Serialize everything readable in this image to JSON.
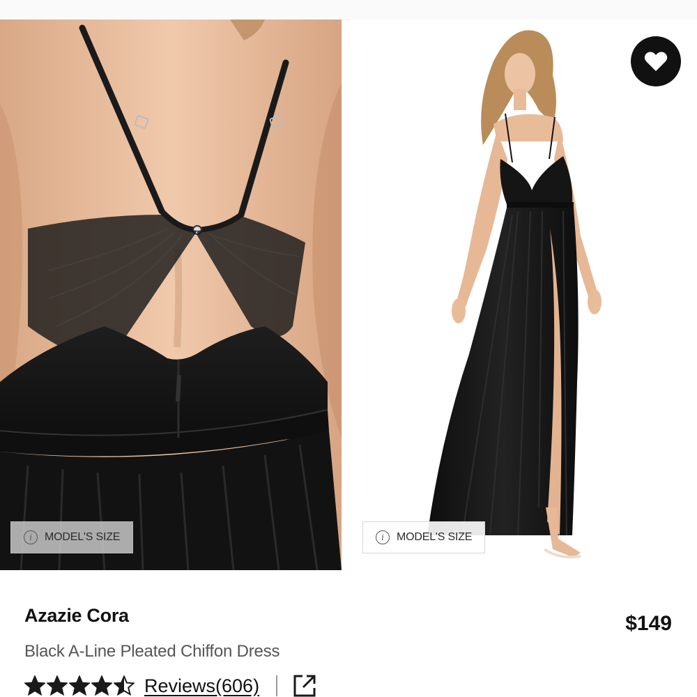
{
  "gallery": {
    "images": [
      {
        "model_size_label": "MODEL'S SIZE"
      },
      {
        "model_size_label": "MODEL'S SIZE"
      }
    ],
    "favorite_icon": "heart-icon"
  },
  "product": {
    "brand_name": "Azazie Cora",
    "description": "Black A-Line Pleated Chiffon Dress",
    "price": "$149",
    "rating": 4.5,
    "rating_max": 5,
    "reviews_label": "Reviews(606)",
    "share_icon": "external-link-icon"
  },
  "colors": {
    "dress": "#161616",
    "skin": "#e9bf9f",
    "favorite_bg": "#111111"
  }
}
